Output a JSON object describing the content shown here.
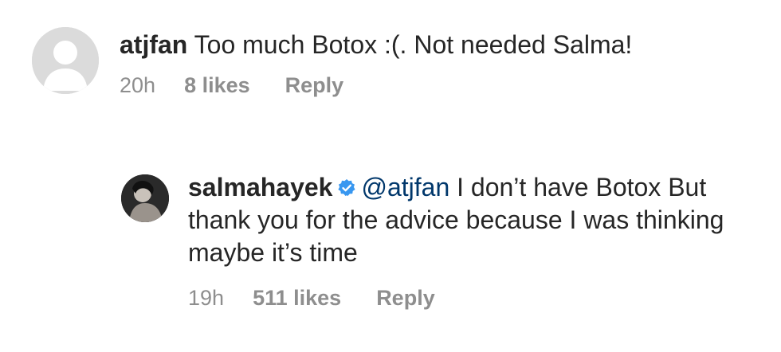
{
  "comments": [
    {
      "username": "atjfan",
      "text": "Too much Botox :(. Not needed Salma!",
      "timestamp": "20h",
      "likes": "8 likes",
      "reply_label": "Reply",
      "avatar": "default-avatar-icon"
    }
  ],
  "reply": {
    "username": "salmahayek",
    "verified": true,
    "verified_color": "#3897f0",
    "mention": "@atjfan",
    "text": "I don’t have Botox But thank you for the advice because I was thinking maybe it’s time",
    "timestamp": "19h",
    "likes": "511 likes",
    "reply_label": "Reply"
  },
  "colors": {
    "text": "#262626",
    "meta": "#8e8e8e",
    "mention": "#00376b",
    "avatar_placeholder": "#dbdbdb"
  }
}
